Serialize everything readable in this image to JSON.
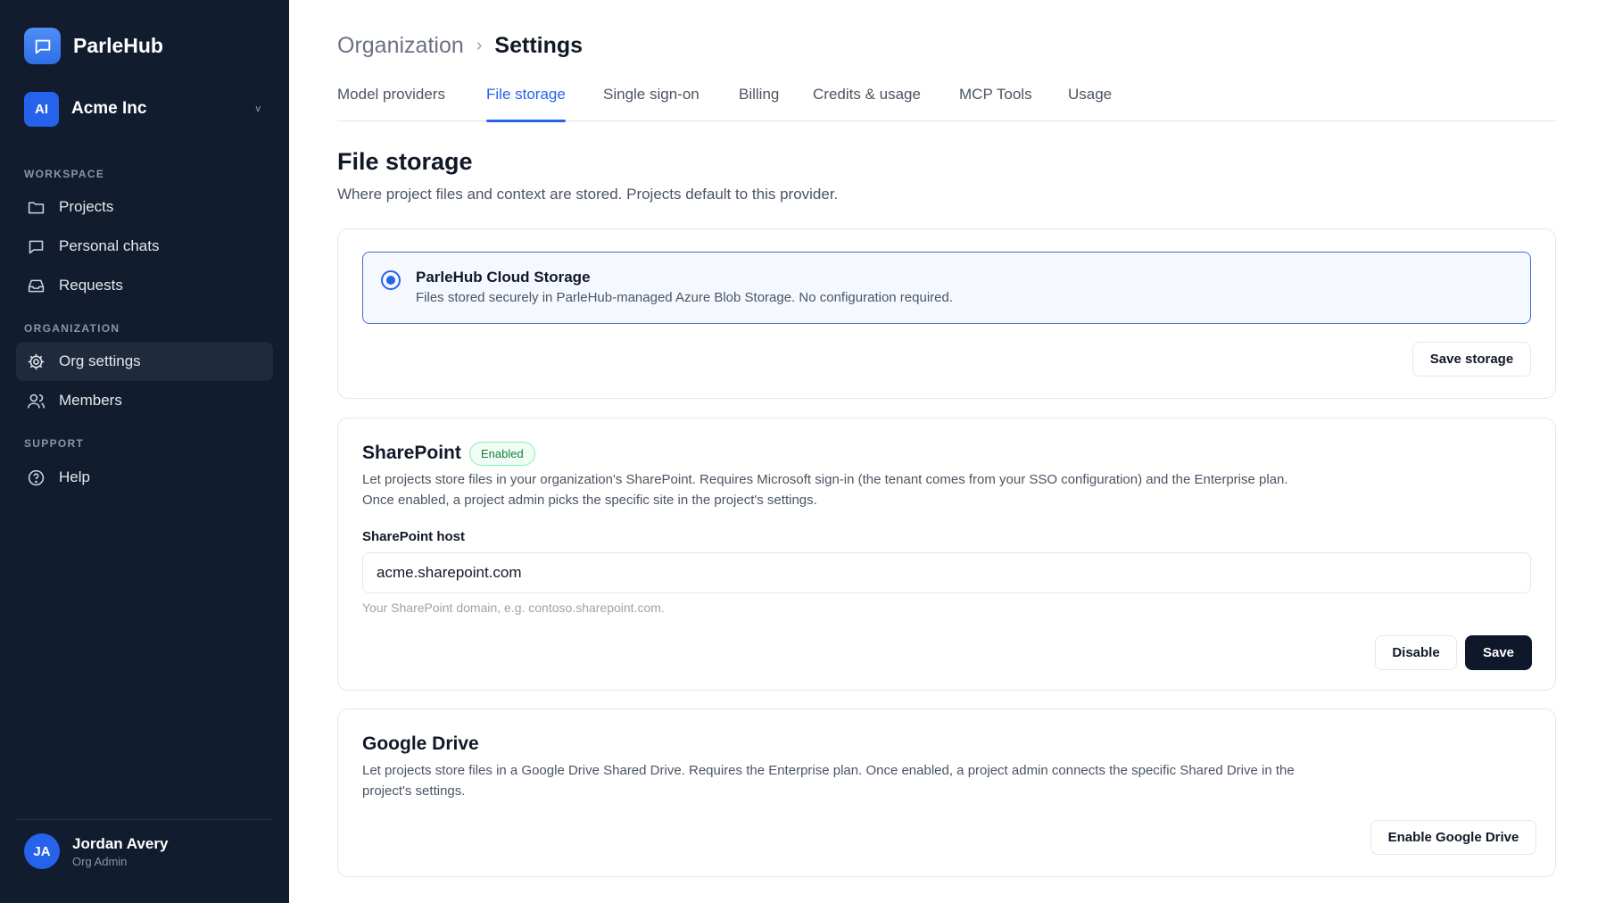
{
  "app": {
    "name": "ParleHub"
  },
  "org": {
    "initials": "AI",
    "name": "Acme Inc",
    "chevron": "v"
  },
  "sidebar": {
    "sections": [
      {
        "label": "WORKSPACE"
      },
      {
        "label": "ORGANIZATION"
      },
      {
        "label": "SUPPORT"
      }
    ],
    "items": [
      {
        "label": "Projects",
        "icon": "folder-icon"
      },
      {
        "label": "Personal chats",
        "icon": "chat-icon"
      },
      {
        "label": "Requests",
        "icon": "inbox-icon"
      },
      {
        "label": "Org settings",
        "icon": "gear-icon",
        "active": true
      },
      {
        "label": "Members",
        "icon": "users-icon"
      },
      {
        "label": "Help",
        "icon": "help-icon"
      }
    ]
  },
  "user": {
    "initials": "JA",
    "name": "Jordan Avery",
    "role": "Org Admin"
  },
  "breadcrumb": {
    "parent": "Organization",
    "separator": "›",
    "current": "Settings"
  },
  "tabs": [
    {
      "label": "Model providers"
    },
    {
      "label": "File storage",
      "active": true
    },
    {
      "label": "Single sign-on"
    },
    {
      "label": "Billing"
    },
    {
      "label": "Credits & usage"
    },
    {
      "label": "MCP Tools"
    },
    {
      "label": "Usage"
    }
  ],
  "page": {
    "title": "File storage",
    "description": "Where project files and context are stored. Projects default to this provider."
  },
  "storage": {
    "option": {
      "name": "ParleHub Cloud Storage",
      "description": "Files stored securely in ParleHub-managed Azure Blob Storage. No configuration required.",
      "selected": true
    },
    "save_label": "Save storage"
  },
  "sharepoint": {
    "title": "SharePoint",
    "badge": "Enabled",
    "description": "Let projects store files in your organization's SharePoint. Requires Microsoft sign-in (the tenant comes from your SSO configuration) and the Enterprise plan. Once enabled, a project admin picks the specific site in the project's settings.",
    "field_label": "SharePoint host",
    "host_value": "acme.sharepoint.com",
    "help_text": "Your SharePoint domain, e.g. contoso.sharepoint.com.",
    "disable_label": "Disable",
    "save_label": "Save"
  },
  "google_drive": {
    "title": "Google Drive",
    "description": "Let projects store files in a Google Drive Shared Drive. Requires the Enterprise plan. Once enabled, a project admin connects the specific Shared Drive in the project's settings.",
    "enable_label": "Enable Google Drive"
  },
  "colors": {
    "sidebar_bg": "#111c2e",
    "accent": "#2563eb",
    "badge_green": "#15803d",
    "dark_button": "#0f172a"
  }
}
